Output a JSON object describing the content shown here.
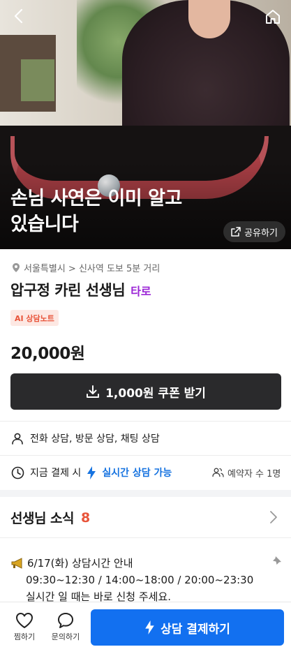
{
  "hero": {
    "title": "손님 사연은 이미 알고\n있습니다",
    "share_label": "공유하기"
  },
  "profile": {
    "location": "서울특별시 > 신사역 도보 5분 거리",
    "name": "압구정 카린 선생님",
    "category": "타로",
    "ai_badge": "AI 상담노트",
    "price": "20,000원",
    "coupon_label": "1,000원 쿠폰 받기",
    "consult_types": "전화 상담, 방문 상담, 채팅 상담",
    "pay_now_prefix": "지금 결제 시",
    "realtime_label": "실시간 상담 가능",
    "reservations": "예약자 수 1명"
  },
  "news": {
    "title": "선생님 소식",
    "count": "8",
    "notice_line1": "6/17(화) 상담시간 안내",
    "notice_line2": "09:30~12:30 / 14:00~18:00 / 20:00~23:30",
    "notice_line3": "실시간 일 때는 바로 신청 주세요."
  },
  "bottom_bar": {
    "like_label": "찜하기",
    "ask_label": "문의하기",
    "pay_label": "상담 결제하기"
  },
  "colors": {
    "accent_blue": "#1270f0",
    "category_purple": "#9b25d6",
    "badge_orange": "#e8543a",
    "dark_button": "#2a2a2c"
  },
  "icons": [
    "back-arrow-icon",
    "home-icon",
    "share-icon",
    "location-pin-icon",
    "download-icon",
    "person-icon",
    "clock-icon",
    "lightning-icon",
    "people-icon",
    "chevron-right-icon",
    "megaphone-icon",
    "pin-icon",
    "heart-icon",
    "chat-bubble-icon"
  ]
}
